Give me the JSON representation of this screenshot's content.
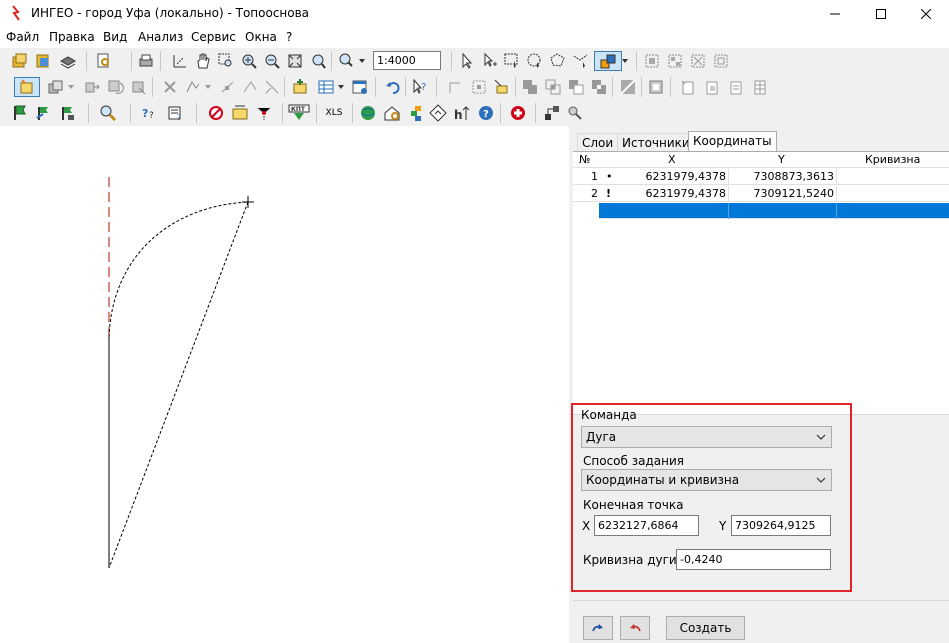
{
  "window": {
    "title": "ИНГЕО - город Уфа (локально) - Топооснова"
  },
  "menu": {
    "items": [
      "Файл",
      "Правка",
      "Вид",
      "Анализ",
      "Сервис",
      "Окна",
      "?"
    ]
  },
  "toolbar": {
    "scale_value": "1:4000",
    "xls_label": "XLS",
    "kpt_label": "КПТ"
  },
  "tabs": [
    {
      "label": "Слои",
      "active": false
    },
    {
      "label": "Источники",
      "active": false
    },
    {
      "label": "Координаты",
      "active": true
    }
  ],
  "grid": {
    "headers": {
      "num": "№",
      "x": "X",
      "y": "Y",
      "curvature": "Кривизна"
    },
    "rows": [
      {
        "num": "1",
        "marker": "•",
        "x": "6231979,4378",
        "y": "7308873,3613",
        "curvature": ""
      },
      {
        "num": "2",
        "marker": "!",
        "x": "6231979,4378",
        "y": "7309121,5240",
        "curvature": ""
      }
    ]
  },
  "command": {
    "command_label": "Команда",
    "command_value": "Дуга",
    "method_label": "Способ задания",
    "method_value": "Координаты и кривизна",
    "endpoint_label": "Конечная точка",
    "x_label": "X",
    "x_value": "6232127,6864",
    "y_label": "Y",
    "y_value": "7309264,9125",
    "curvature_label": "Кривизна дуги",
    "curvature_value": "-0,4240"
  },
  "buttons": {
    "create_label": "Создать"
  },
  "colors": {
    "highlight_frame": "#e1242a",
    "selection": "#0078d7",
    "guide_line": "#c0392b"
  }
}
